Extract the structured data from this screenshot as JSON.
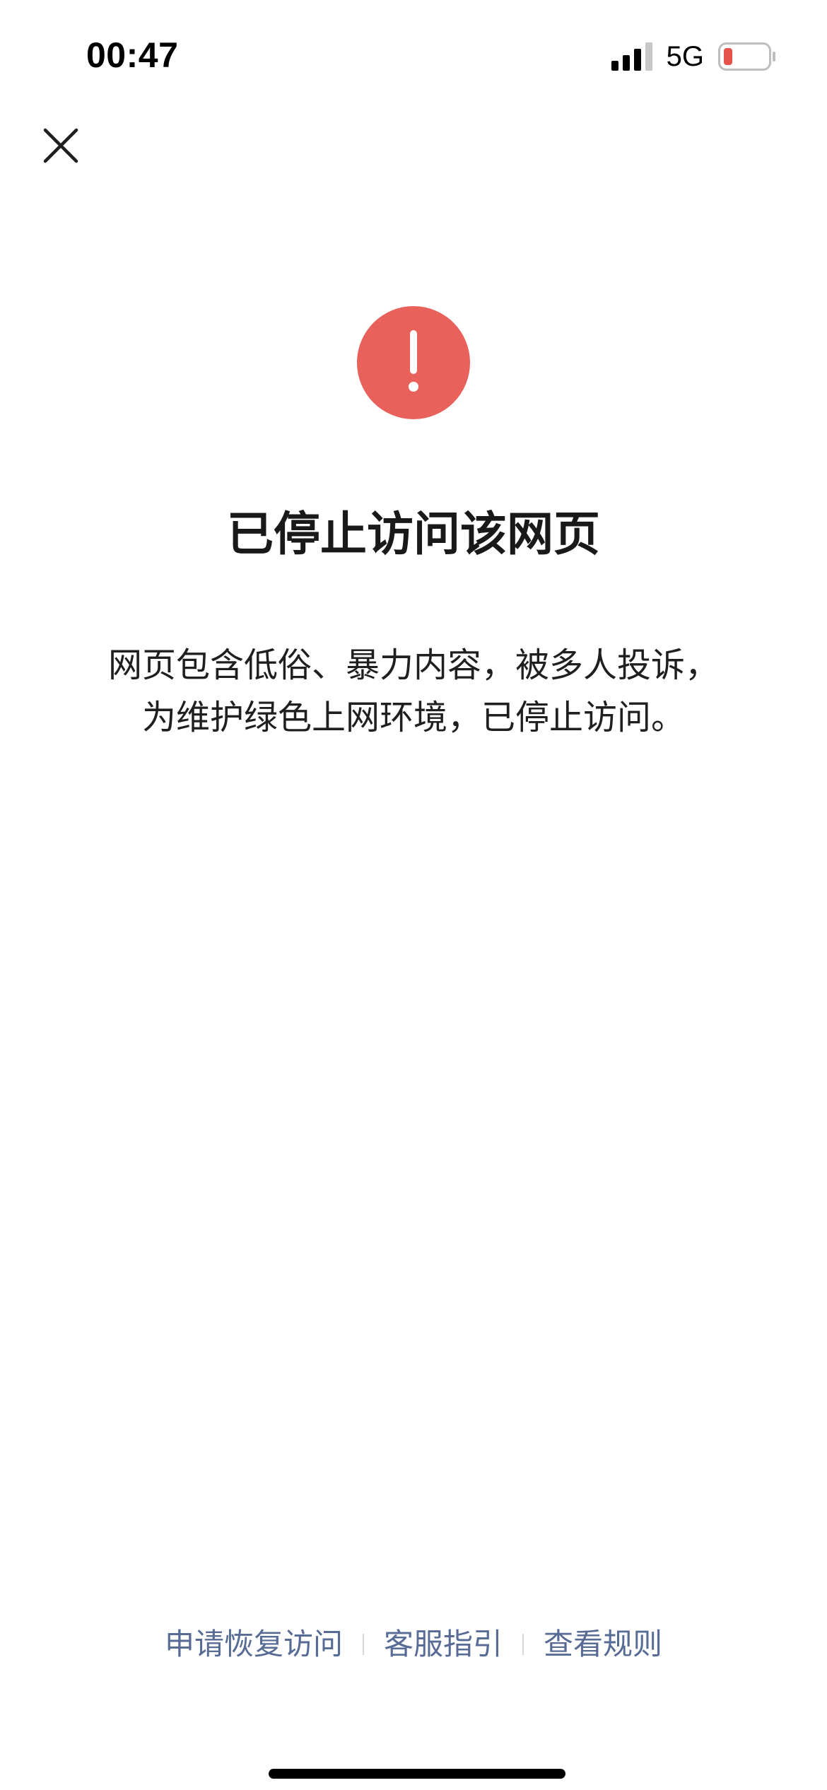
{
  "status_bar": {
    "time": "00:47",
    "network": "5G",
    "icons": [
      "signal-icon",
      "battery-icon"
    ],
    "battery_color": "#e5534b"
  },
  "close_icon": "close-icon",
  "alert": {
    "icon": "exclamation-icon",
    "color": "#e8615b"
  },
  "title": "已停止访问该网页",
  "description": {
    "line1": "网页包含低俗、暴力内容，被多人投诉，",
    "line2": "为维护绿色上网环境，已停止访问。"
  },
  "footer": {
    "link_color": "#576b95",
    "links": [
      "申请恢复访问",
      "客服指引",
      "查看规则"
    ]
  }
}
